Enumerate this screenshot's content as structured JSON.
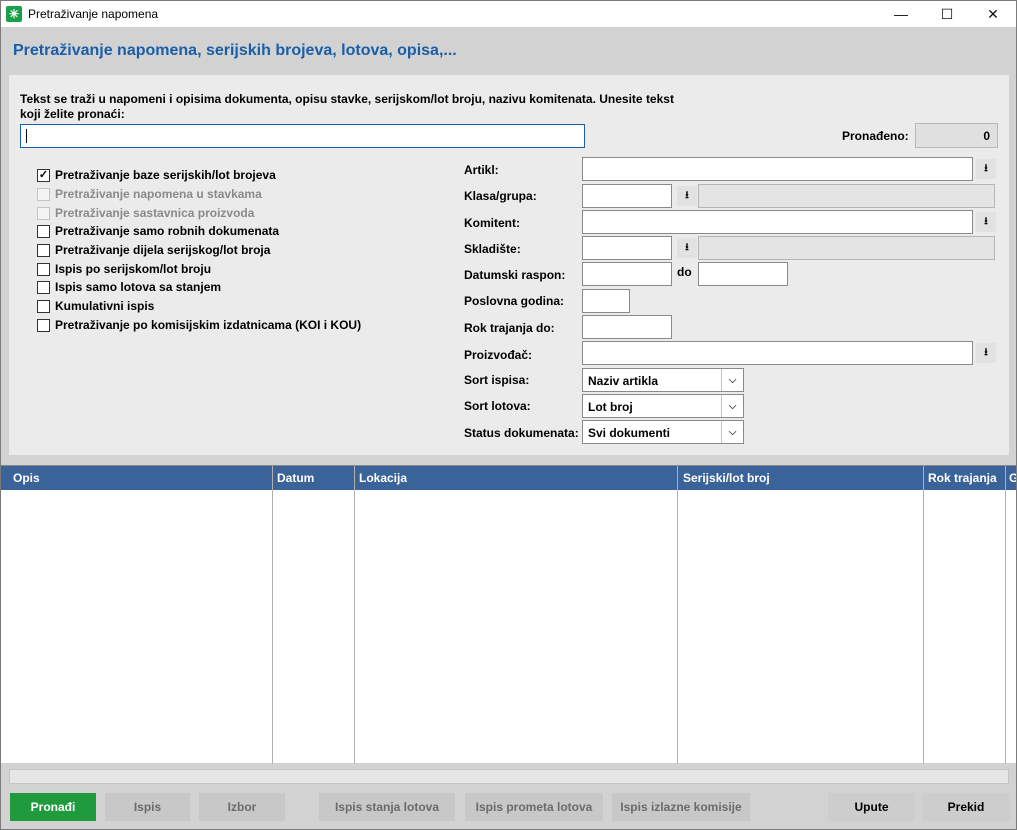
{
  "window": {
    "title": "Pretraživanje napomena",
    "minimize": "—",
    "maximize": "☐",
    "close": "✕"
  },
  "heading": "Pretraživanje napomena, serijskih brojeva, lotova, opisa,...",
  "search": {
    "description": "Tekst se traži u napomeni i opisima dokumenta, opisu stavke, serijskom/lot broju, nazivu komitenata. Unesite tekst koji želite pronaći:",
    "value": "",
    "found_label": "Pronađeno:",
    "found_value": "0"
  },
  "options": [
    {
      "label": "Pretraživanje baze serijskih/lot brojeva",
      "checked": true,
      "disabled": false
    },
    {
      "label": "Pretraživanje napomena u stavkama",
      "checked": false,
      "disabled": true
    },
    {
      "label": "Pretraživanje sastavnica proizvoda",
      "checked": false,
      "disabled": true
    },
    {
      "label": "Pretraživanje samo robnih dokumenata",
      "checked": false,
      "disabled": false
    },
    {
      "label": "Pretraživanje dijela serijskog/lot broja",
      "checked": false,
      "disabled": false
    },
    {
      "label": "Ispis po serijskom/lot broju",
      "checked": false,
      "disabled": false
    },
    {
      "label": "Ispis samo lotova sa stanjem",
      "checked": false,
      "disabled": false
    },
    {
      "label": "Kumulativni ispis",
      "checked": false,
      "disabled": false
    },
    {
      "label": "Pretraživanje po komisijskim izdatnicama (KOI i KOU)",
      "checked": false,
      "disabled": false
    }
  ],
  "filters": {
    "artikl": "Artikl:",
    "klasa": "Klasa/grupa:",
    "komitent": "Komitent:",
    "skladiste": "Skladište:",
    "datum": "Datumski raspon:",
    "do": "do",
    "godina": "Poslovna godina:",
    "rok": "Rok trajanja do:",
    "proizvodac": "Proizvođač:",
    "sort_ispisa": "Sort ispisa:",
    "sort_lotova": "Sort lotova:",
    "status": "Status dokumenata:"
  },
  "selects": {
    "sort_ispisa": "Naziv artikla",
    "sort_lotova": "Lot broj",
    "status": "Svi dokumenti"
  },
  "icons": {
    "dropdown": "⭳",
    "chevron": "⌵",
    "check": "✓"
  },
  "table": {
    "columns": [
      "Opis",
      "Datum",
      "Lokacija",
      "Serijski/lot broj",
      "Rok trajanja",
      "G"
    ]
  },
  "buttons": {
    "pronadi": "Pronađi",
    "ispis": "Ispis",
    "izbor": "Izbor",
    "ispis_stanja": "Ispis stanja lotova",
    "ispis_prometa": "Ispis prometa lotova",
    "ispis_komisije": "Ispis izlazne komisije",
    "upute": "Upute",
    "prekid": "Prekid"
  },
  "colors": {
    "accent": "#1a5ea8",
    "header": "#3a6399",
    "primary_button": "#1f9a3d"
  }
}
